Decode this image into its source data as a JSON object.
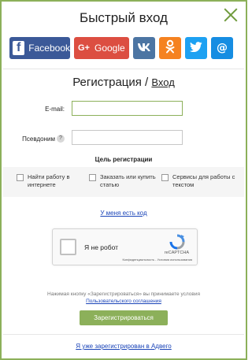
{
  "header": {
    "title": "Быстрый вход",
    "close_icon": "close-icon"
  },
  "social": {
    "facebook_label": "Facebook",
    "google_label": "Google",
    "google_icon_text": "G+",
    "icons": [
      "facebook-icon",
      "google-plus-icon",
      "vk-icon",
      "odnoklassniki-icon",
      "twitter-icon",
      "mail-icon"
    ],
    "colors": {
      "facebook": "#3b5998",
      "google": "#dc4e41",
      "vk": "#4c75a3",
      "ok": "#f58220",
      "twitter": "#1da1f2",
      "mail": "#168de2"
    }
  },
  "form": {
    "title": "Регистрация",
    "separator": "/",
    "login_link": "Вход",
    "email_label": "E-mail:",
    "email_value": "",
    "nickname_label": "Псевдоним",
    "nickname_help": "?",
    "nickname_value": "",
    "purpose_title": "Цель регистрации",
    "purposes": [
      {
        "label": "Найти работу в интернете",
        "checked": false
      },
      {
        "label": "Заказать или купить статью",
        "checked": false
      },
      {
        "label": "Сервисы для работы с текстом",
        "checked": false
      }
    ],
    "have_code_link": "У меня есть код"
  },
  "recaptcha": {
    "label": "Я не робот",
    "brand": "reCAPTCHA",
    "terms": "Конфиденциальность - Условия использования",
    "checked": false
  },
  "footer": {
    "agree_text": "Нажимая кнопку «Зарегистрироваться» вы принимаете условия",
    "agree_link": "Пользовательского соглашения",
    "submit_label": "Зарегистрироваться",
    "already_link": "Я уже зарегистрирован в Адвего"
  },
  "accent_color": "#8cb05a"
}
